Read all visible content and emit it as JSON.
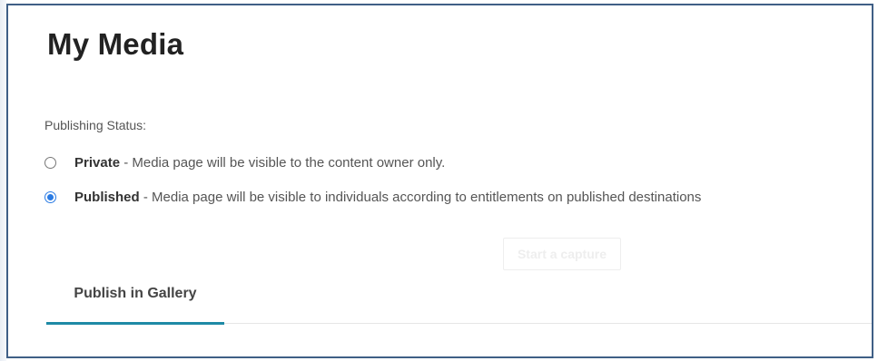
{
  "page": {
    "title": "My Media"
  },
  "publishing": {
    "label": "Publishing Status:",
    "options": [
      {
        "name": "Private",
        "description": " - Media page will be visible to the content owner only.",
        "selected": false
      },
      {
        "name": "Published",
        "description": " - Media page will be visible to individuals according to entitlements on published destinations",
        "selected": true
      }
    ]
  },
  "capture": {
    "label": "Start a capture"
  },
  "tabs": [
    {
      "label": "Publish in Gallery",
      "active": true
    }
  ],
  "colors": {
    "accent": "#2a7be4",
    "tab_underline": "#1e8aa6",
    "frame_border": "#3f5f86"
  }
}
